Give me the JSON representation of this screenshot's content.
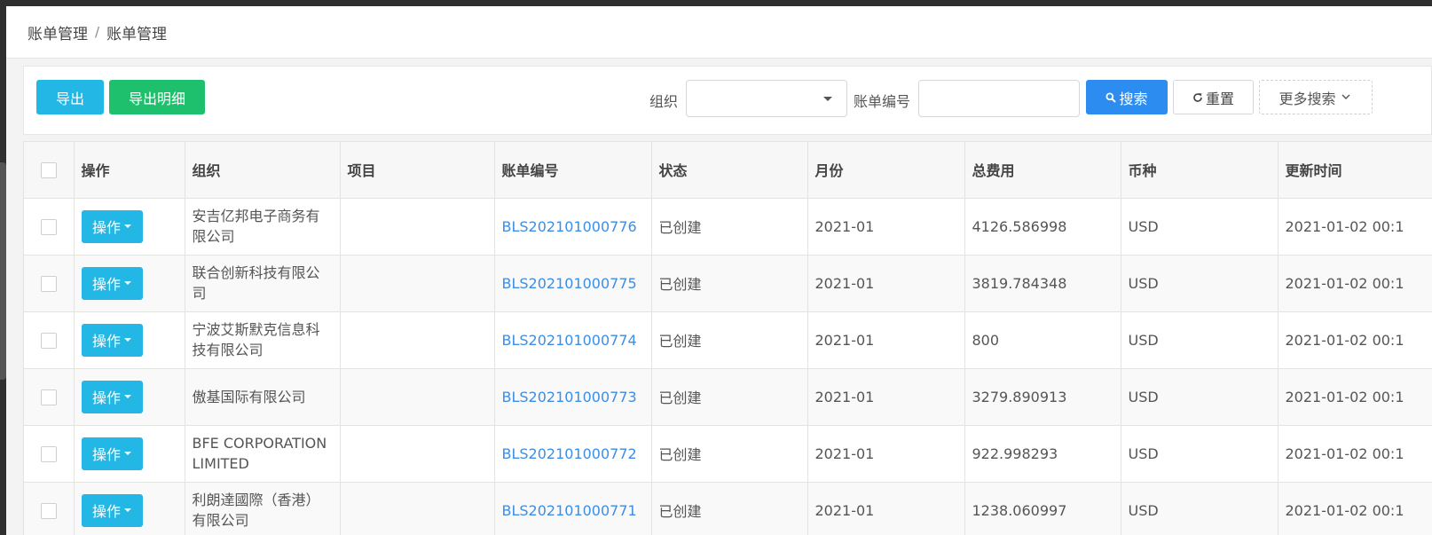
{
  "breadcrumb": {
    "items": [
      "账单管理",
      "账单管理"
    ],
    "separator": "/"
  },
  "toolbar": {
    "export_label": "导出",
    "export_detail_label": "导出明细",
    "org_label": "组织",
    "org_value": "",
    "bill_no_label": "账单编号",
    "bill_no_value": "",
    "search_label": "搜索",
    "reset_label": "重置",
    "more_search_label": "更多搜索"
  },
  "table": {
    "columns": [
      "操作",
      "组织",
      "项目",
      "账单编号",
      "状态",
      "月份",
      "总费用",
      "币种",
      "更新时间"
    ],
    "op_label": "操作",
    "rows": [
      {
        "org": "安吉亿邦电子商务有限公司",
        "project": "",
        "bill_no": "BLS202101000776",
        "status": "已创建",
        "month": "2021-01",
        "total": "4126.586998",
        "currency": "USD",
        "updated": "2021-01-02 00:1"
      },
      {
        "org": "联合创新科技有限公司",
        "project": "",
        "bill_no": "BLS202101000775",
        "status": "已创建",
        "month": "2021-01",
        "total": "3819.784348",
        "currency": "USD",
        "updated": "2021-01-02 00:1"
      },
      {
        "org": "宁波艾斯默克信息科技有限公司",
        "project": "",
        "bill_no": "BLS202101000774",
        "status": "已创建",
        "month": "2021-01",
        "total": "800",
        "currency": "USD",
        "updated": "2021-01-02 00:1"
      },
      {
        "org": "傲基国际有限公司",
        "project": "",
        "bill_no": "BLS202101000773",
        "status": "已创建",
        "month": "2021-01",
        "total": "3279.890913",
        "currency": "USD",
        "updated": "2021-01-02 00:1"
      },
      {
        "org": "BFE CORPORATION LIMITED",
        "project": "",
        "bill_no": "BLS202101000772",
        "status": "已创建",
        "month": "2021-01",
        "total": "922.998293",
        "currency": "USD",
        "updated": "2021-01-02 00:1"
      },
      {
        "org": "利朗達國際（香港）有限公司",
        "project": "",
        "bill_no": "BLS202101000771",
        "status": "已创建",
        "month": "2021-01",
        "total": "1238.060997",
        "currency": "USD",
        "updated": "2021-01-02 00:1"
      }
    ]
  },
  "colors": {
    "primary_cyan": "#23b7e5",
    "green": "#1ec06d",
    "search_blue": "#2d8cf0",
    "link_blue": "#3a8ee6"
  }
}
